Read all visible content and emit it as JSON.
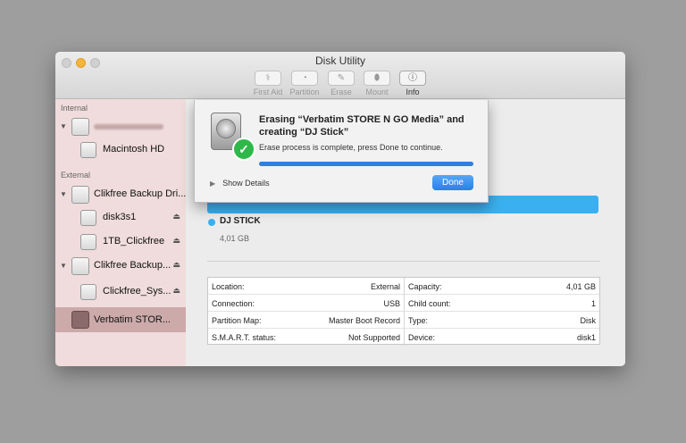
{
  "window": {
    "title": "Disk Utility"
  },
  "toolbar": [
    {
      "label": "First Aid",
      "icon": "stethoscope-icon",
      "glyph": "⚕",
      "active": false
    },
    {
      "label": "Partition",
      "icon": "partition-icon",
      "glyph": "◔",
      "active": false
    },
    {
      "label": "Erase",
      "icon": "erase-icon",
      "glyph": "✎",
      "active": false
    },
    {
      "label": "Mount",
      "icon": "mount-icon",
      "glyph": "⬮",
      "active": false
    },
    {
      "label": "Info",
      "icon": "info-icon",
      "glyph": "ⓘ",
      "active": true
    }
  ],
  "sidebar": {
    "internal_label": "Internal",
    "external_label": "External",
    "items": [
      {
        "label": "",
        "redacted": true
      },
      {
        "label": "Macintosh HD"
      },
      {
        "label": "Clikfree Backup Dri..."
      },
      {
        "label": "disk3s1"
      },
      {
        "label": "1TB_Clickfree"
      },
      {
        "label": "Clikfree Backup..."
      },
      {
        "label": "Clickfree_Sys..."
      },
      {
        "label": "Verbatim STOR..."
      }
    ]
  },
  "volume": {
    "name": "DJ STICK",
    "size": "4,01 GB",
    "color": "#3ab0f0"
  },
  "info_table": {
    "left": [
      {
        "k": "Location:",
        "v": "External"
      },
      {
        "k": "Connection:",
        "v": "USB"
      },
      {
        "k": "Partition Map:",
        "v": "Master Boot Record"
      },
      {
        "k": "S.M.A.R.T. status:",
        "v": "Not Supported"
      }
    ],
    "right": [
      {
        "k": "Capacity:",
        "v": "4,01 GB"
      },
      {
        "k": "Child count:",
        "v": "1"
      },
      {
        "k": "Type:",
        "v": "Disk"
      },
      {
        "k": "Device:",
        "v": "disk1"
      }
    ]
  },
  "dialog": {
    "title": "Erasing “Verbatim STORE N GO Media” and creating “DJ Stick”",
    "message": "Erase process is complete, press Done to continue.",
    "progress": 1.0,
    "show_details": "Show Details",
    "done_label": "Done"
  }
}
